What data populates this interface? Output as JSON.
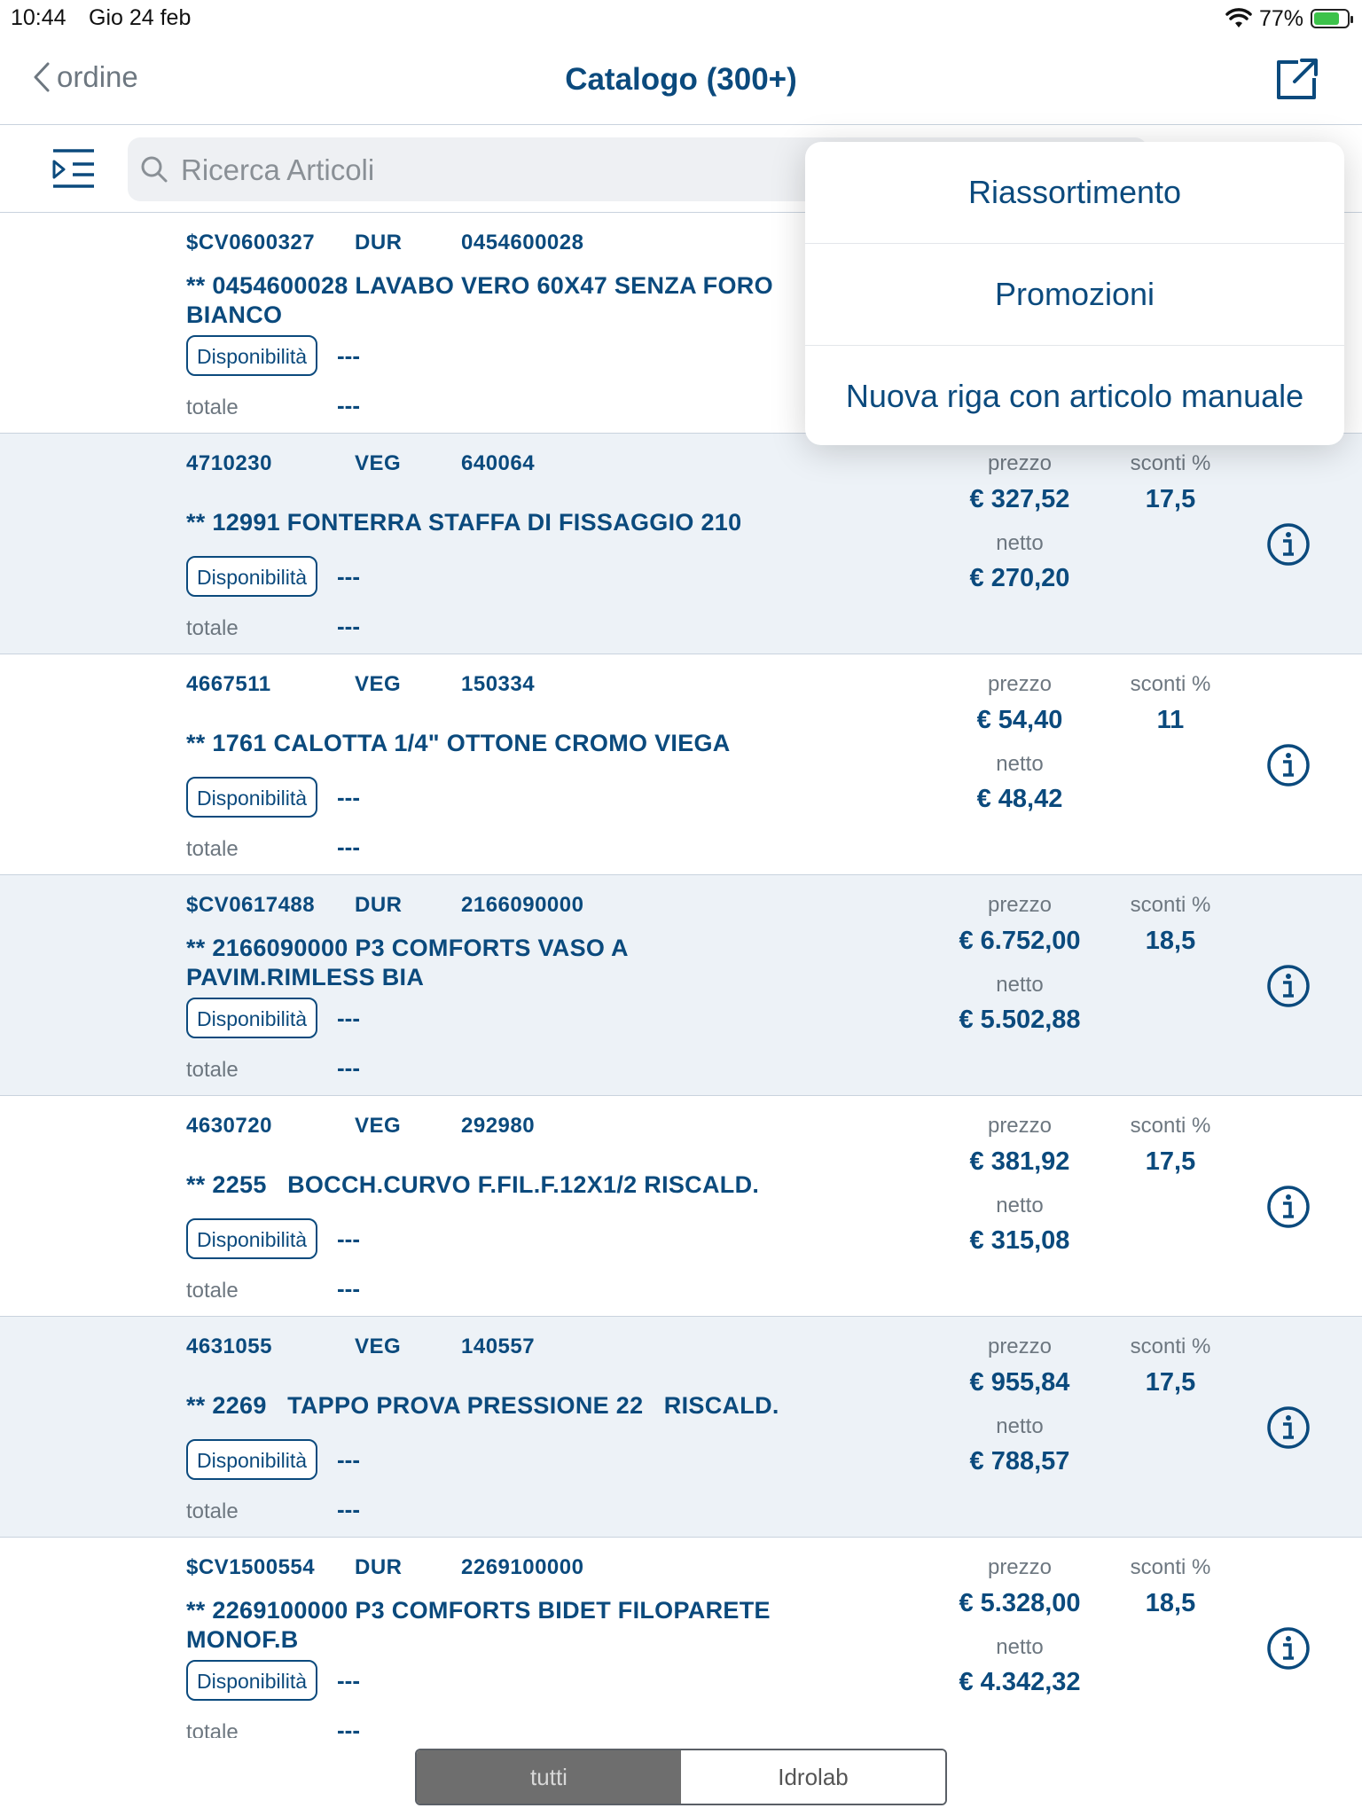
{
  "status_bar": {
    "time": "10:44",
    "date": "Gio 24 feb",
    "battery": "77%"
  },
  "nav": {
    "back_label": "ordine",
    "title": "Catalogo (300+)"
  },
  "search": {
    "placeholder": "Ricerca Articoli"
  },
  "popover": {
    "items": [
      "Riassortimento",
      "Promozioni",
      "Nuova riga con articolo manuale"
    ]
  },
  "labels": {
    "availability": "Disponibilità",
    "total": "totale",
    "price": "prezzo",
    "discounts": "sconti %",
    "net": "netto"
  },
  "articles": [
    {
      "code1": "$CV0600327",
      "brand": "DUR",
      "code2": "0454600028",
      "desc": "** 0454600028 LAVABO VERO 60X47 SENZA FORO BIANCO",
      "availability": "---",
      "total": "---",
      "price": "",
      "discount": "",
      "net": ""
    },
    {
      "code1": "4710230",
      "brand": "VEG",
      "code2": "640064",
      "desc": "** 12991 FONTERRA STAFFA DI FISSAGGIO 210",
      "availability": "---",
      "total": "---",
      "price": "€ 327,52",
      "discount": "17,5",
      "net": "€ 270,20"
    },
    {
      "code1": "4667511",
      "brand": "VEG",
      "code2": "150334",
      "desc": "** 1761 CALOTTA 1/4\" OTTONE CROMO VIEGA",
      "availability": "---",
      "total": "---",
      "price": "€ 54,40",
      "discount": "11",
      "net": "€ 48,42"
    },
    {
      "code1": "$CV0617488",
      "brand": "DUR",
      "code2": "2166090000",
      "desc": "** 2166090000 P3 COMFORTS VASO A PAVIM.RIMLESS BIA",
      "availability": "---",
      "total": "---",
      "price": "€ 6.752,00",
      "discount": "18,5",
      "net": "€ 5.502,88"
    },
    {
      "code1": "4630720",
      "brand": "VEG",
      "code2": "292980",
      "desc": "** 2255   BOCCH.CURVO F.FIL.F.12X1/2 RISCALD.",
      "availability": "---",
      "total": "---",
      "price": "€ 381,92",
      "discount": "17,5",
      "net": "€ 315,08"
    },
    {
      "code1": "4631055",
      "brand": "VEG",
      "code2": "140557",
      "desc": "** 2269   TAPPO PROVA PRESSIONE 22   RISCALD.",
      "availability": "---",
      "total": "---",
      "price": "€ 955,84",
      "discount": "17,5",
      "net": "€ 788,57"
    },
    {
      "code1": "$CV1500554",
      "brand": "DUR",
      "code2": "2269100000",
      "desc": "** 2269100000 P3 COMFORTS BIDET FILOPARETE MONOF.B",
      "availability": "---",
      "total": "---",
      "price": "€ 5.328,00",
      "discount": "18,5",
      "net": "€ 4.342,32"
    }
  ],
  "segments": {
    "all": "tutti",
    "idrolab": "Idrolab"
  },
  "colors": {
    "accent": "#0b4a7d",
    "row_alt": "#edf2f7",
    "segment_active": "#6e6e6e"
  }
}
